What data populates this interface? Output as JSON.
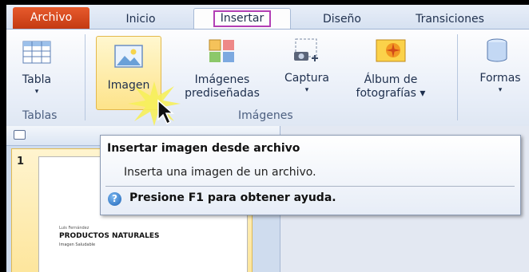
{
  "tabs": {
    "file": "Archivo",
    "home": "Inicio",
    "insert": "Insertar",
    "design": "Diseño",
    "transitions": "Transiciones"
  },
  "ribbon": {
    "table": {
      "line1": "Tabla",
      "caret": "▾"
    },
    "image": {
      "line1": "Imagen"
    },
    "clipart": {
      "line1": "Imágenes",
      "line2": "prediseñadas"
    },
    "capture": {
      "line1": "Captura",
      "caret": "▾"
    },
    "album": {
      "line1": "Álbum de",
      "line2": "fotografías ▾"
    },
    "shapes": {
      "line1": "Formas",
      "caret": "▾"
    },
    "groups": {
      "tables": "Tablas",
      "images": "Imágenes"
    }
  },
  "slides": {
    "number": "1",
    "author": "Luis Fernández",
    "title": "PRODUCTOS NATURALES",
    "subtitle": "Imagen Saludable"
  },
  "tooltip": {
    "title": "Insertar imagen desde archivo",
    "description": "Inserta una imagen de un archivo.",
    "help": "Presione F1 para obtener ayuda."
  },
  "colors": {
    "file_tab": "#d94c20",
    "insert_highlight": "#b23fb5",
    "selected_button": "#fde38a"
  },
  "icons": [
    "table-icon",
    "image-icon",
    "clipart-icon",
    "screenshot-icon",
    "photo-album-icon",
    "shapes-icon",
    "help-icon",
    "cursor-icon"
  ]
}
